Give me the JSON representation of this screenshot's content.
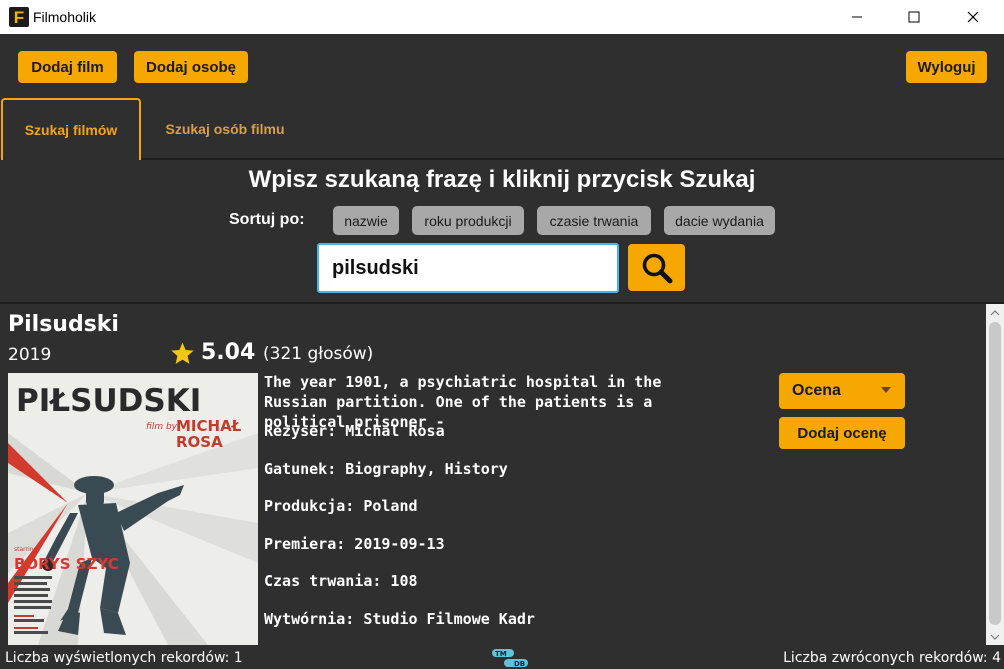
{
  "window": {
    "title": "Filmoholik",
    "logo_letter": "F",
    "controls": [
      "minimize",
      "maximize",
      "close"
    ]
  },
  "toolbar": {
    "add_film": "Dodaj film",
    "add_person": "Dodaj osobę",
    "logout": "Wyloguj"
  },
  "tabs": [
    {
      "label": "Szukaj filmów",
      "active": true
    },
    {
      "label": "Szukaj osób filmu",
      "active": false
    }
  ],
  "search": {
    "heading": "Wpisz szukaną frazę i kliknij przycisk Szukaj",
    "sort_label": "Sortuj po:",
    "sort_options": [
      "nazwie",
      "roku produkcji",
      "czasie trwania",
      "dacie wydania"
    ],
    "query": "pilsudski",
    "button_icon": "search-icon"
  },
  "result": {
    "title": "Pilsudski",
    "year": "2019",
    "rating": "5.04",
    "votes": "(321 głosów)",
    "poster": {
      "title": "PIŁSUDSKI",
      "film_by": "film by",
      "director_line1": "MICHAŁ",
      "director_line2": "ROSA",
      "starring": "starring",
      "lead": "BORYS SZYC"
    },
    "description": "The year 1901, a psychiatric hospital in the Russian partition. One of the patients is a political prisoner -",
    "director": "Reżyser: Michal Rosa",
    "genre": "Gatunek: Biography, History",
    "production": "Produkcja: Poland",
    "premiere": "Premiera: 2019-09-13",
    "duration": "Czas trwania: 108",
    "studio": "Wytwórnia: Studio Filmowe Kadr",
    "rate_select": "Ocena",
    "add_rating": "Dodaj ocenę"
  },
  "status": {
    "displayed": "Liczba wyświetlonych rekordów: 1",
    "returned": "Liczba zwróconych rekordów: 4",
    "tmdb_top": "TM",
    "tmdb_bottom": "DB"
  },
  "colors": {
    "accent": "#f7a800",
    "background": "#2f2f2f",
    "input_border": "#42b6ee"
  }
}
